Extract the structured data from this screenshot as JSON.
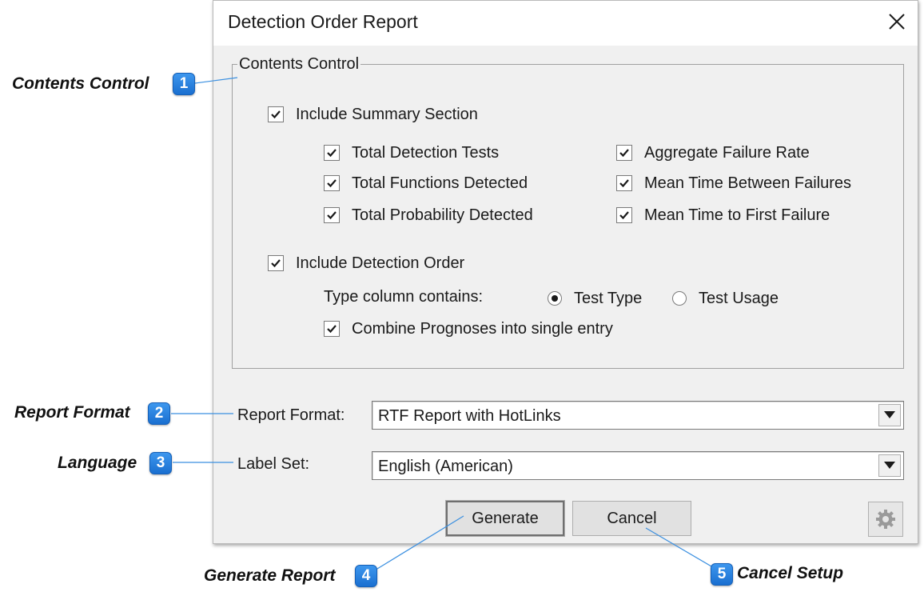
{
  "dialog": {
    "title": "Detection Order Report",
    "contents": {
      "legend": "Contents Control",
      "include_summary": {
        "label": "Include Summary Section",
        "checked": true
      },
      "summary_left": [
        {
          "label": "Total Detection Tests",
          "checked": true
        },
        {
          "label": "Total Functions Detected",
          "checked": true
        },
        {
          "label": "Total Probability Detected",
          "checked": true
        }
      ],
      "summary_right": [
        {
          "label": "Aggregate Failure Rate",
          "checked": true
        },
        {
          "label": "Mean Time Between Failures",
          "checked": true
        },
        {
          "label": "Mean Time to First Failure",
          "checked": true
        }
      ],
      "include_detection": {
        "label": "Include Detection Order",
        "checked": true
      },
      "type_column_label": "Type column contains:",
      "type_options": [
        {
          "label": "Test Type",
          "selected": true
        },
        {
          "label": "Test Usage",
          "selected": false
        }
      ],
      "combine": {
        "label": "Combine Prognoses into single entry",
        "checked": true
      }
    },
    "report_format": {
      "label": "Report Format:",
      "value": "RTF Report with HotLinks"
    },
    "label_set": {
      "label": "Label Set:",
      "value": "English (American)"
    },
    "buttons": {
      "generate": "Generate",
      "cancel": "Cancel"
    }
  },
  "callouts": [
    {
      "num": "1",
      "text": "Contents Control"
    },
    {
      "num": "2",
      "text": "Report Format"
    },
    {
      "num": "3",
      "text": "Language"
    },
    {
      "num": "4",
      "text": "Generate Report"
    },
    {
      "num": "5",
      "text": "Cancel Setup"
    }
  ],
  "colors": {
    "badge": "#2a84e0",
    "dialog_bg": "#f0f0f0",
    "leader_line": "#3a8fe0"
  }
}
